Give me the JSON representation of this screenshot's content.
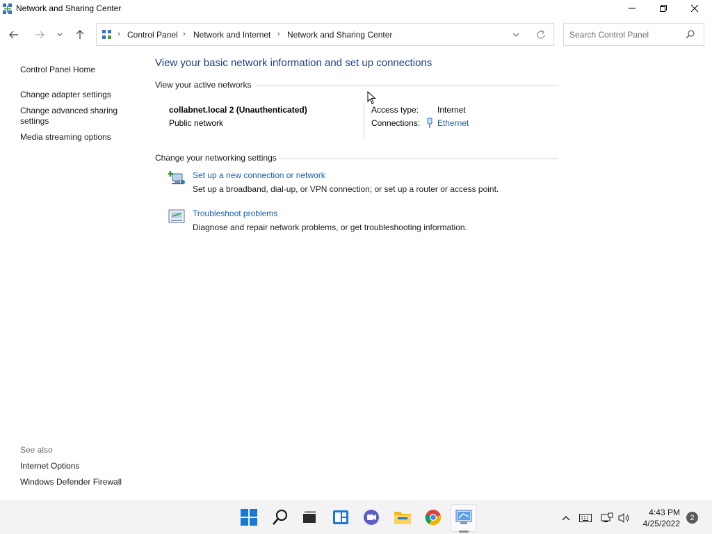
{
  "window": {
    "title": "Network and Sharing Center"
  },
  "address_bar": {
    "breadcrumbs": [
      "Control Panel",
      "Network and Internet",
      "Network and Sharing Center"
    ]
  },
  "search": {
    "placeholder": "Search Control Panel"
  },
  "left_pane": {
    "home": "Control Panel Home",
    "links": [
      "Change adapter settings",
      "Change advanced sharing settings",
      "Media streaming options"
    ],
    "see_also_label": "See also",
    "see_also": [
      "Internet Options",
      "Windows Defender Firewall"
    ]
  },
  "main": {
    "heading": "View your basic network information and set up connections",
    "active_networks": {
      "section_title": "View your active networks",
      "network_name": "collabnet.local 2 (Unauthenticated)",
      "network_type": "Public network",
      "access_type_label": "Access type:",
      "access_type_value": "Internet",
      "connections_label": "Connections:",
      "connections_value": "Ethernet"
    },
    "settings": {
      "section_title": "Change your networking settings",
      "tasks": [
        {
          "icon": "new-connection-icon",
          "label": "Set up a new connection or network",
          "description": "Set up a broadband, dial-up, or VPN connection; or set up a router or access point."
        },
        {
          "icon": "troubleshoot-icon",
          "label": "Troubleshoot problems",
          "description": "Diagnose and repair network problems, or get troubleshooting information."
        }
      ]
    }
  },
  "taskbar": {
    "time": "4:43 PM",
    "date": "4/25/2022",
    "notification_count": "2"
  },
  "colors": {
    "heading": "#1e3f8c",
    "link": "#1a5fb4",
    "taskbar_bg": "#f3f3f3"
  }
}
